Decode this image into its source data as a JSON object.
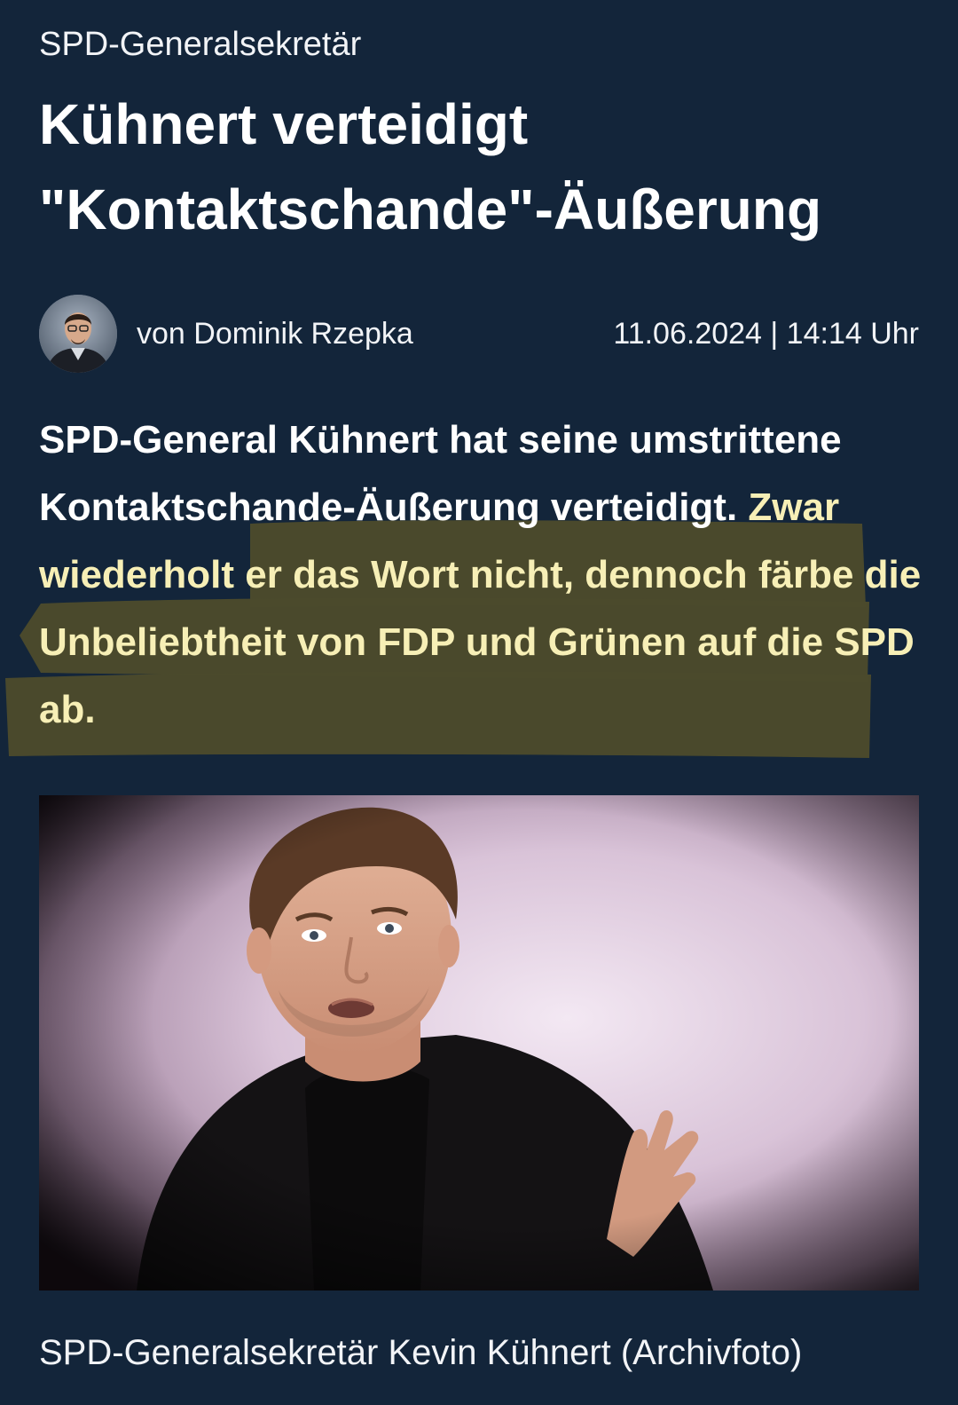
{
  "article": {
    "kicker": "SPD-Generalsekretär",
    "headline_line1": "Kühnert verteidigt",
    "headline_line2": "\"Kontaktschande\"-Äußerung",
    "author": "von Dominik Rzepka",
    "date": "11.06.2024 | 14:14 Uhr",
    "lead_plain": "SPD-General Kühnert hat seine umstrittene Kontaktschande-Äußerung verteidigt.",
    "lead_highlighted": " Zwar wiederholt er das Wort nicht, dennoch färbe die Unbeliebtheit von FDP und Grünen auf die SPD ab.",
    "image_caption": "SPD-Generalsekretär Kevin Kühnert (Archivfoto)"
  },
  "colors": {
    "background": "#13253a",
    "highlight_marker": "#4b4a2c",
    "highlight_text": "#f7efb6",
    "text": "#ffffff"
  }
}
